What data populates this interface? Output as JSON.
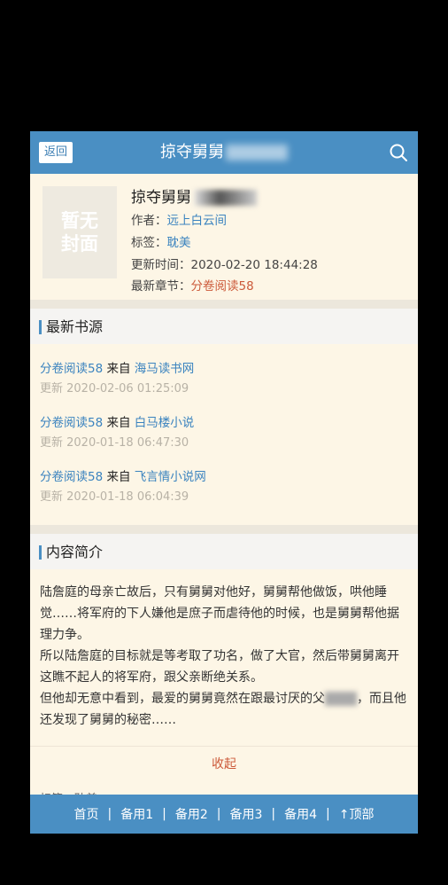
{
  "topbar": {
    "back_label": "返回",
    "title": "掠夺舅舅"
  },
  "book": {
    "cover_text": "暂无封面",
    "title": "掠夺舅舅",
    "author_label": "作者：",
    "author": "远上白云间",
    "tag_label": "标签：",
    "tag": "耽美",
    "updated_label": "更新时间：",
    "updated": "2020-02-20 18:44:28",
    "latest_label": "最新章节：",
    "latest": "分卷阅读58"
  },
  "sources": {
    "heading": "最新书源",
    "from_label": "来自",
    "items": [
      {
        "chapter": "分卷阅读58",
        "site": "海马读书网",
        "time": "更新 2020-02-06 01:25:09"
      },
      {
        "chapter": "分卷阅读58",
        "site": "白马楼小说",
        "time": "更新 2020-01-18 06:47:30"
      },
      {
        "chapter": "分卷阅读58",
        "site": "飞言情小说网",
        "time": "更新 2020-01-18 06:04:39"
      }
    ]
  },
  "intro": {
    "heading": "内容简介",
    "p1": "陆詹庭的母亲亡故后，只有舅舅对他好，舅舅帮他做饭，哄他睡觉……将军府的下人嫌他是庶子而虐待他的时候，也是舅舅帮他据理力争。",
    "p2": "所以陆詹庭的目标就是等考取了功名，做了大官，然后带舅舅离开这瞧不起人的将军府，跟父亲断绝关系。",
    "p3a": "但他却无意中看到，最爱的舅舅竟然在跟最讨厌的父",
    "p3b": "，而且他还发现了舅舅的秘密……",
    "collapse": "收起",
    "peek": "标签：耽美"
  },
  "bottom_nav": {
    "items": [
      "首页",
      "备用1",
      "备用2",
      "备用3",
      "备用4",
      "↑顶部"
    ]
  },
  "colors": {
    "accent": "#4a8fc3",
    "link": "#3a83bf",
    "highlight": "#cc5a3a",
    "background": "#fdf6e6"
  }
}
